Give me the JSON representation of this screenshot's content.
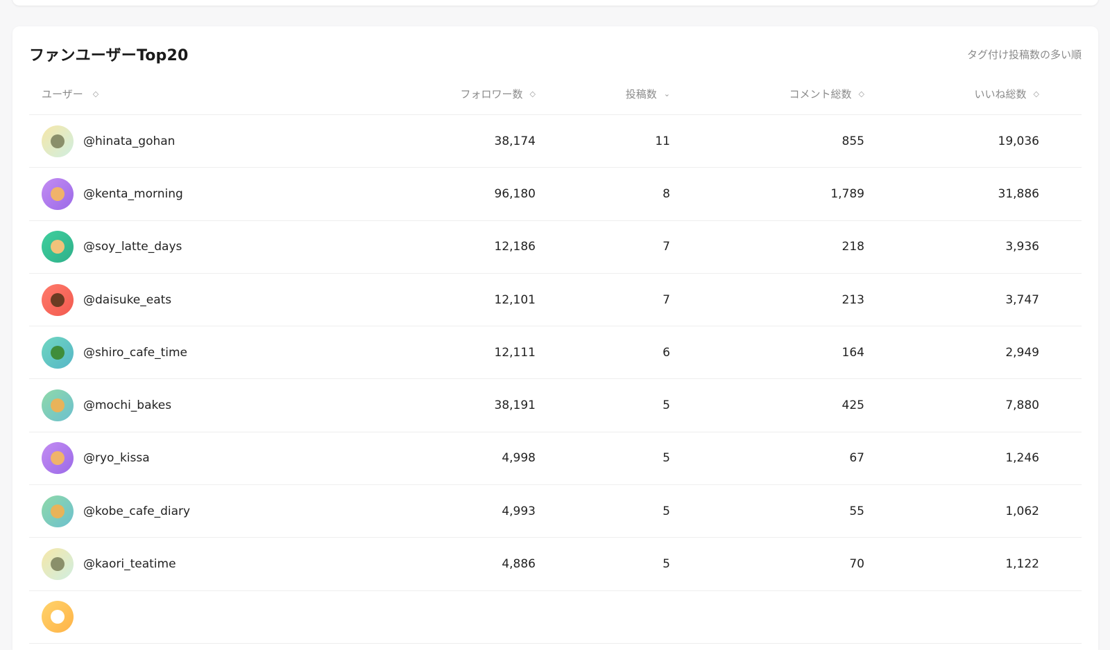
{
  "card": {
    "title": "ファンユーザーTop20",
    "subtitle": "タグ付け投稿数の多い順"
  },
  "columns": {
    "user": "ユーザー",
    "followers": "フォロワー数",
    "posts": "投稿数",
    "comments": "コメント総数",
    "likes": "いいね総数"
  },
  "colors": {
    "accent": "#1a1a1a",
    "muted": "#8a8a8a"
  },
  "rows": [
    {
      "handle": "@hinata_gohan",
      "followers": "38,174",
      "posts": "11",
      "comments": "855",
      "likes": "19,036",
      "avatar": {
        "icon": "matcha-icon",
        "bg": "linear-gradient(135deg,#f6e7a8,#cfeee0)",
        "fg": "#8a8f6a"
      }
    },
    {
      "handle": "@kenta_morning",
      "followers": "96,180",
      "posts": "8",
      "comments": "1,789",
      "likes": "31,886",
      "avatar": {
        "icon": "pancake-icon",
        "bg": "linear-gradient(135deg,#c38cf2,#9b6ae8)",
        "fg": "#f0b36a"
      }
    },
    {
      "handle": "@soy_latte_days",
      "followers": "12,186",
      "posts": "7",
      "comments": "218",
      "likes": "3,936",
      "avatar": {
        "icon": "toast-icon",
        "bg": "linear-gradient(135deg,#3fcf9d,#2fb08a)",
        "fg": "#f1c27a"
      }
    },
    {
      "handle": "@daisuke_eats",
      "followers": "12,101",
      "posts": "7",
      "comments": "213",
      "likes": "3,747",
      "avatar": {
        "icon": "coffee-icon",
        "bg": "linear-gradient(135deg,#ff7a6b,#f25a4f)",
        "fg": "#6a3b22"
      }
    },
    {
      "handle": "@shiro_cafe_time",
      "followers": "12,111",
      "posts": "6",
      "comments": "164",
      "likes": "2,949",
      "avatar": {
        "icon": "salad-icon",
        "bg": "linear-gradient(135deg,#6fd6c0,#56b6c7)",
        "fg": "#3f8d3a"
      }
    },
    {
      "handle": "@mochi_bakes",
      "followers": "38,191",
      "posts": "5",
      "comments": "425",
      "likes": "7,880",
      "avatar": {
        "icon": "cupcake-icon",
        "bg": "linear-gradient(135deg,#8fd9a8,#6cc0cf)",
        "fg": "#e8b35a"
      }
    },
    {
      "handle": "@ryo_kissa",
      "followers": "4,998",
      "posts": "5",
      "comments": "67",
      "likes": "1,246",
      "avatar": {
        "icon": "pancake-icon",
        "bg": "linear-gradient(135deg,#c38cf2,#9b6ae8)",
        "fg": "#f0b36a"
      }
    },
    {
      "handle": "@kobe_cafe_diary",
      "followers": "4,993",
      "posts": "5",
      "comments": "55",
      "likes": "1,062",
      "avatar": {
        "icon": "cupcake-icon",
        "bg": "linear-gradient(135deg,#8fd9a8,#6cc0cf)",
        "fg": "#e8b35a"
      }
    },
    {
      "handle": "@kaori_teatime",
      "followers": "4,886",
      "posts": "5",
      "comments": "70",
      "likes": "1,122",
      "avatar": {
        "icon": "matcha-icon",
        "bg": "linear-gradient(135deg,#f6e7a8,#cfeee0)",
        "fg": "#8a8f6a"
      }
    },
    {
      "handle": "",
      "followers": "",
      "posts": "",
      "comments": "",
      "likes": "",
      "avatar": {
        "icon": "avatar-icon",
        "bg": "linear-gradient(135deg,#ffd36b,#ffb347)",
        "fg": "#ffffff"
      }
    }
  ]
}
